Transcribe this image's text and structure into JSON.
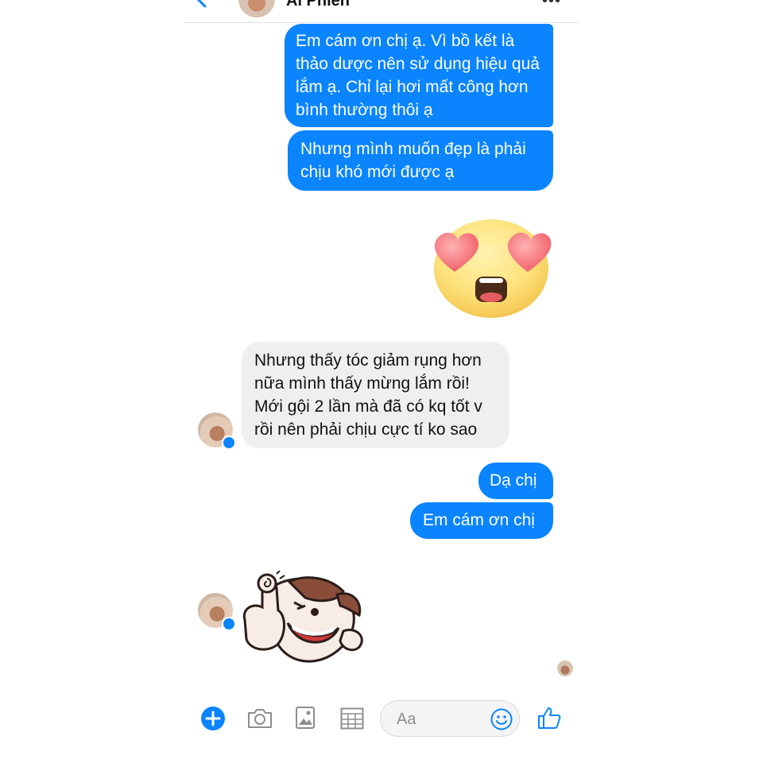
{
  "header": {
    "title": "Ái Phiên"
  },
  "messages": {
    "m1": "Em cám ơn chị ạ. Vì bồ kết là thảo dược nên sử dụng hiệu quả lắm ạ. Chỉ lại hơi mất công hơn bình thường thôi ạ",
    "m2": "Nhưng mình muốn đẹp là phải chịu khó mới được ạ",
    "m3": "Nhưng thấy tóc giảm rụng hơn nữa mình thấy mừng lắm rồi! Mới gội 2 lần mà đã có kq tốt v rồi nên phải chịu cực tí ko sao",
    "m4": "Dạ chị",
    "m5": "Em cám ơn chị"
  },
  "composer": {
    "placeholder": "Aa"
  },
  "icons": [
    "back-icon",
    "more-icon",
    "heart-eyes-emoji",
    "thumbs-up-sticker",
    "plus-icon",
    "camera-icon",
    "image-icon",
    "gif-grid-icon",
    "smiley-icon",
    "like-icon",
    "messenger-badge-icon"
  ],
  "colors": {
    "accent": "#0a84ff",
    "incoming": "#efefef"
  }
}
